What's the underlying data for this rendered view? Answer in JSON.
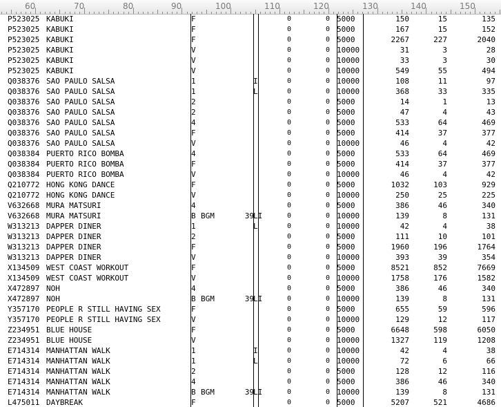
{
  "ruler": {
    "labels": [
      "60",
      "70",
      "80",
      "90",
      "100",
      "110",
      "120",
      "130",
      "140",
      "150"
    ]
  },
  "rows": [
    {
      "code": "P523025",
      "title": "KABUKI",
      "flag": "F",
      "tag": "",
      "num": "",
      "suffix": "",
      "z1": "0",
      "z2": "0",
      "v1": "5000",
      "v2": "150",
      "v3": "15",
      "v4": "135"
    },
    {
      "code": "P523025",
      "title": "KABUKI",
      "flag": "F",
      "tag": "",
      "num": "",
      "suffix": "",
      "z1": "0",
      "z2": "0",
      "v1": "5000",
      "v2": "167",
      "v3": "15",
      "v4": "152"
    },
    {
      "code": "P523025",
      "title": "KABUKI",
      "flag": "F",
      "tag": "",
      "num": "",
      "suffix": "",
      "z1": "0",
      "z2": "0",
      "v1": "5000",
      "v2": "2267",
      "v3": "227",
      "v4": "2040"
    },
    {
      "code": "P523025",
      "title": "KABUKI",
      "flag": "V",
      "tag": "",
      "num": "",
      "suffix": "",
      "z1": "0",
      "z2": "0",
      "v1": "10000",
      "v2": "31",
      "v3": "3",
      "v4": "28"
    },
    {
      "code": "P523025",
      "title": "KABUKI",
      "flag": "V",
      "tag": "",
      "num": "",
      "suffix": "",
      "z1": "0",
      "z2": "0",
      "v1": "10000",
      "v2": "33",
      "v3": "3",
      "v4": "30"
    },
    {
      "code": "P523025",
      "title": "KABUKI",
      "flag": "V",
      "tag": "",
      "num": "",
      "suffix": "",
      "z1": "0",
      "z2": "0",
      "v1": "10000",
      "v2": "549",
      "v3": "55",
      "v4": "494"
    },
    {
      "code": "Q038376",
      "title": "SAO PAULO SALSA",
      "flag": "1",
      "tag": "",
      "num": "",
      "suffix": "I",
      "z1": "0",
      "z2": "0",
      "v1": "10000",
      "v2": "108",
      "v3": "11",
      "v4": "97"
    },
    {
      "code": "Q038376",
      "title": "SAO PAULO SALSA",
      "flag": "1",
      "tag": "",
      "num": "",
      "suffix": "L",
      "z1": "0",
      "z2": "0",
      "v1": "10000",
      "v2": "368",
      "v3": "33",
      "v4": "335"
    },
    {
      "code": "Q038376",
      "title": "SAO PAULO SALSA",
      "flag": "2",
      "tag": "",
      "num": "",
      "suffix": "",
      "z1": "0",
      "z2": "0",
      "v1": "5000",
      "v2": "14",
      "v3": "1",
      "v4": "13"
    },
    {
      "code": "Q038376",
      "title": "SAO PAULO SALSA",
      "flag": "2",
      "tag": "",
      "num": "",
      "suffix": "",
      "z1": "0",
      "z2": "0",
      "v1": "5000",
      "v2": "47",
      "v3": "4",
      "v4": "43"
    },
    {
      "code": "Q038376",
      "title": "SAO PAULO SALSA",
      "flag": "4",
      "tag": "",
      "num": "",
      "suffix": "",
      "z1": "0",
      "z2": "0",
      "v1": "5000",
      "v2": "533",
      "v3": "64",
      "v4": "469"
    },
    {
      "code": "Q038376",
      "title": "SAO PAULO SALSA",
      "flag": "F",
      "tag": "",
      "num": "",
      "suffix": "",
      "z1": "0",
      "z2": "0",
      "v1": "5000",
      "v2": "414",
      "v3": "37",
      "v4": "377"
    },
    {
      "code": "Q038376",
      "title": "SAO PAULO SALSA",
      "flag": "V",
      "tag": "",
      "num": "",
      "suffix": "",
      "z1": "0",
      "z2": "0",
      "v1": "10000",
      "v2": "46",
      "v3": "4",
      "v4": "42"
    },
    {
      "code": "Q038384",
      "title": "PUERTO RICO BOMBA",
      "flag": "4",
      "tag": "",
      "num": "",
      "suffix": "",
      "z1": "0",
      "z2": "0",
      "v1": "5000",
      "v2": "533",
      "v3": "64",
      "v4": "469"
    },
    {
      "code": "Q038384",
      "title": "PUERTO RICO BOMBA",
      "flag": "F",
      "tag": "",
      "num": "",
      "suffix": "",
      "z1": "0",
      "z2": "0",
      "v1": "5000",
      "v2": "414",
      "v3": "37",
      "v4": "377"
    },
    {
      "code": "Q038384",
      "title": "PUERTO RICO BOMBA",
      "flag": "V",
      "tag": "",
      "num": "",
      "suffix": "",
      "z1": "0",
      "z2": "0",
      "v1": "10000",
      "v2": "46",
      "v3": "4",
      "v4": "42"
    },
    {
      "code": "Q210772",
      "title": "HONG KONG DANCE",
      "flag": "F",
      "tag": "",
      "num": "",
      "suffix": "",
      "z1": "0",
      "z2": "0",
      "v1": "5000",
      "v2": "1032",
      "v3": "103",
      "v4": "929"
    },
    {
      "code": "Q210772",
      "title": "HONG KONG DANCE",
      "flag": "V",
      "tag": "",
      "num": "",
      "suffix": "",
      "z1": "0",
      "z2": "0",
      "v1": "10000",
      "v2": "250",
      "v3": "25",
      "v4": "225"
    },
    {
      "code": "V632668",
      "title": "MURA MATSURI",
      "flag": "4",
      "tag": "",
      "num": "",
      "suffix": "",
      "z1": "0",
      "z2": "0",
      "v1": "5000",
      "v2": "386",
      "v3": "46",
      "v4": "340"
    },
    {
      "code": "V632668",
      "title": "MURA MATSURI",
      "flag": "B",
      "tag": "BGM",
      "num": "39",
      "suffix": "LI",
      "z1": "0",
      "z2": "0",
      "v1": "10000",
      "v2": "139",
      "v3": "8",
      "v4": "131"
    },
    {
      "code": "W313213",
      "title": "DAPPER DINER",
      "flag": "1",
      "tag": "",
      "num": "",
      "suffix": "L",
      "z1": "0",
      "z2": "0",
      "v1": "10000",
      "v2": "42",
      "v3": "4",
      "v4": "38"
    },
    {
      "code": "W313213",
      "title": "DAPPER DINER",
      "flag": "2",
      "tag": "",
      "num": "",
      "suffix": "",
      "z1": "0",
      "z2": "0",
      "v1": "5000",
      "v2": "111",
      "v3": "10",
      "v4": "101"
    },
    {
      "code": "W313213",
      "title": "DAPPER DINER",
      "flag": "F",
      "tag": "",
      "num": "",
      "suffix": "",
      "z1": "0",
      "z2": "0",
      "v1": "5000",
      "v2": "1960",
      "v3": "196",
      "v4": "1764"
    },
    {
      "code": "W313213",
      "title": "DAPPER DINER",
      "flag": "V",
      "tag": "",
      "num": "",
      "suffix": "",
      "z1": "0",
      "z2": "0",
      "v1": "10000",
      "v2": "393",
      "v3": "39",
      "v4": "354"
    },
    {
      "code": "X134509",
      "title": "WEST COAST WORKOUT",
      "flag": "F",
      "tag": "",
      "num": "",
      "suffix": "",
      "z1": "0",
      "z2": "0",
      "v1": "5000",
      "v2": "8521",
      "v3": "852",
      "v4": "7669"
    },
    {
      "code": "X134509",
      "title": "WEST COAST WORKOUT",
      "flag": "V",
      "tag": "",
      "num": "",
      "suffix": "",
      "z1": "0",
      "z2": "0",
      "v1": "10000",
      "v2": "1758",
      "v3": "176",
      "v4": "1582"
    },
    {
      "code": "X472897",
      "title": "NOH",
      "flag": "4",
      "tag": "",
      "num": "",
      "suffix": "",
      "z1": "0",
      "z2": "0",
      "v1": "5000",
      "v2": "386",
      "v3": "46",
      "v4": "340"
    },
    {
      "code": "X472897",
      "title": "NOH",
      "flag": "B",
      "tag": "BGM",
      "num": "39",
      "suffix": "LI",
      "z1": "0",
      "z2": "0",
      "v1": "10000",
      "v2": "139",
      "v3": "8",
      "v4": "131"
    },
    {
      "code": "Y357170",
      "title": "PEOPLE R STILL HAVING SEX",
      "flag": "F",
      "tag": "",
      "num": "",
      "suffix": "",
      "z1": "0",
      "z2": "0",
      "v1": "5000",
      "v2": "655",
      "v3": "59",
      "v4": "596"
    },
    {
      "code": "Y357170",
      "title": "PEOPLE R STILL HAVING SEX",
      "flag": "V",
      "tag": "",
      "num": "",
      "suffix": "",
      "z1": "0",
      "z2": "0",
      "v1": "10000",
      "v2": "129",
      "v3": "12",
      "v4": "117"
    },
    {
      "code": "Z234951",
      "title": "BLUE HOUSE",
      "flag": "F",
      "tag": "",
      "num": "",
      "suffix": "",
      "z1": "0",
      "z2": "0",
      "v1": "5000",
      "v2": "6648",
      "v3": "598",
      "v4": "6050"
    },
    {
      "code": "Z234951",
      "title": "BLUE HOUSE",
      "flag": "V",
      "tag": "",
      "num": "",
      "suffix": "",
      "z1": "0",
      "z2": "0",
      "v1": "10000",
      "v2": "1327",
      "v3": "119",
      "v4": "1208"
    },
    {
      "code": "E714314",
      "title": "MANHATTAN WALK",
      "flag": "1",
      "tag": "",
      "num": "",
      "suffix": "I",
      "z1": "0",
      "z2": "0",
      "v1": "10000",
      "v2": "42",
      "v3": "4",
      "v4": "38"
    },
    {
      "code": "E714314",
      "title": "MANHATTAN WALK",
      "flag": "1",
      "tag": "",
      "num": "",
      "suffix": "L",
      "z1": "0",
      "z2": "0",
      "v1": "10000",
      "v2": "72",
      "v3": "6",
      "v4": "66"
    },
    {
      "code": "E714314",
      "title": "MANHATTAN WALK",
      "flag": "2",
      "tag": "",
      "num": "",
      "suffix": "",
      "z1": "0",
      "z2": "0",
      "v1": "5000",
      "v2": "128",
      "v3": "12",
      "v4": "116"
    },
    {
      "code": "E714314",
      "title": "MANHATTAN WALK",
      "flag": "4",
      "tag": "",
      "num": "",
      "suffix": "",
      "z1": "0",
      "z2": "0",
      "v1": "5000",
      "v2": "386",
      "v3": "46",
      "v4": "340"
    },
    {
      "code": "E714314",
      "title": "MANHATTAN WALK",
      "flag": "B",
      "tag": "BGM",
      "num": "39",
      "suffix": "LI",
      "z1": "0",
      "z2": "0",
      "v1": "10000",
      "v2": "139",
      "v3": "8",
      "v4": "131"
    },
    {
      "code": "L475011",
      "title": "DAYBREAK",
      "flag": "F",
      "tag": "",
      "num": "",
      "suffix": "",
      "z1": "0",
      "z2": "0",
      "v1": "5000",
      "v2": "5207",
      "v3": "521",
      "v4": "4686"
    }
  ]
}
